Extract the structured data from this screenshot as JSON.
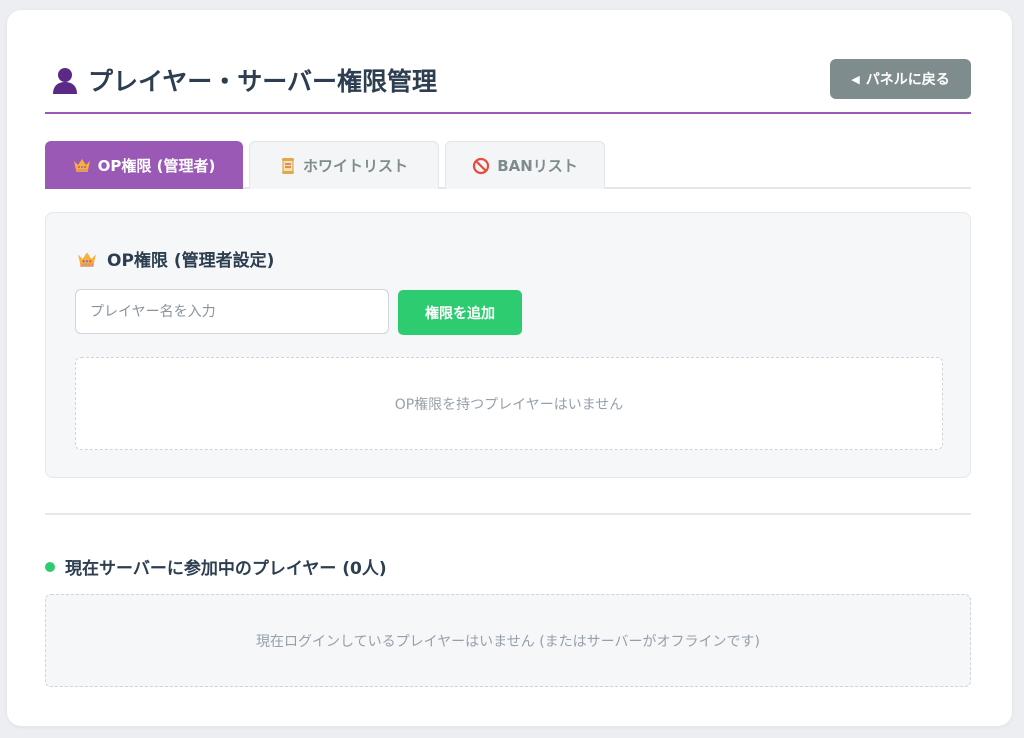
{
  "header": {
    "title": "プレイヤー・サーバー権限管理",
    "title_icon": "user-icon",
    "back_button_label": "パネルに戻る",
    "accent_color": "#9b59b6"
  },
  "tabs": [
    {
      "label": "OP権限 (管理者)",
      "icon": "crown-icon",
      "active": true
    },
    {
      "label": "ホワイトリスト",
      "icon": "scroll-icon",
      "active": false
    },
    {
      "label": "BANリスト",
      "icon": "prohibited-icon",
      "active": false
    }
  ],
  "op_panel": {
    "title": "OP権限 (管理者設定)",
    "input_placeholder": "プレイヤー名を入力",
    "input_value": "",
    "add_button_label": "権限を追加",
    "empty_message": "OP権限を持つプレイヤーはいません"
  },
  "online": {
    "title": "現在サーバーに参加中のプレイヤー (0人)",
    "empty_message": "現在ログインしているプレイヤーはいません (またはサーバーがオフラインです)",
    "status_color": "#2ecc71"
  }
}
